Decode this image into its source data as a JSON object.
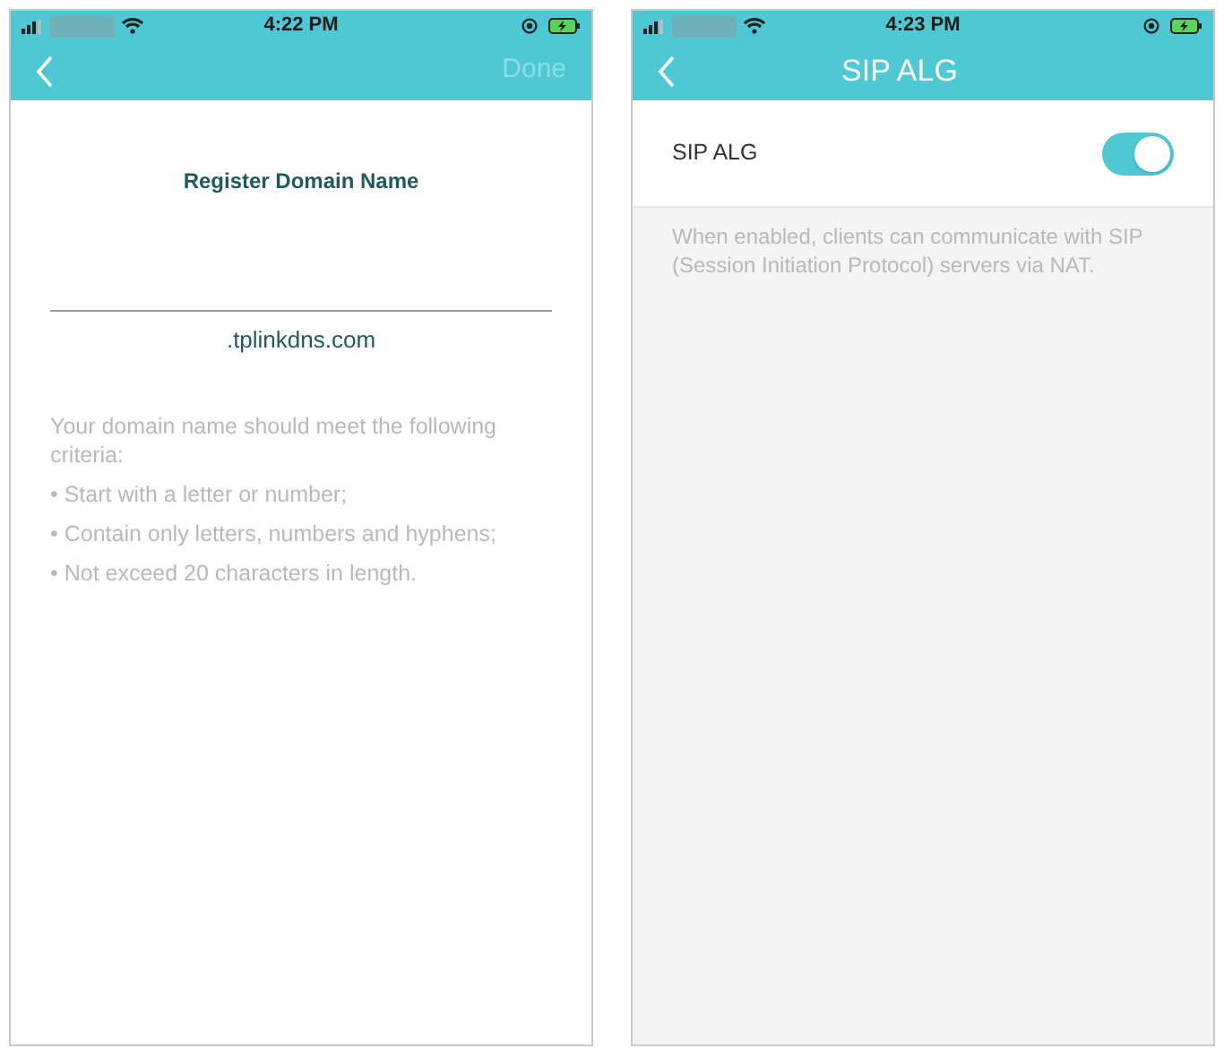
{
  "screens": [
    {
      "kind": "register",
      "status_bar": {
        "time": "4:22 PM"
      },
      "nav": {
        "action": {
          "label": "Done",
          "disabled": true
        }
      },
      "heading": "Register Domain Name",
      "suffix": ".tplinkdns.com",
      "criteria_intro": "Your domain name should meet the following criteria:",
      "criteria": [
        "• Start with a letter or number;",
        "• Contain only letters, numbers and hyphens;",
        "• Not exceed 20 characters in length."
      ]
    },
    {
      "kind": "setting",
      "status_bar": {
        "time": "4:23 PM"
      },
      "nav": {
        "title": "SIP ALG"
      },
      "setting": {
        "label": "SIP ALG",
        "on": true
      },
      "description": "When enabled, clients can communicate with SIP (Session Initiation Protocol) servers via NAT."
    }
  ]
}
